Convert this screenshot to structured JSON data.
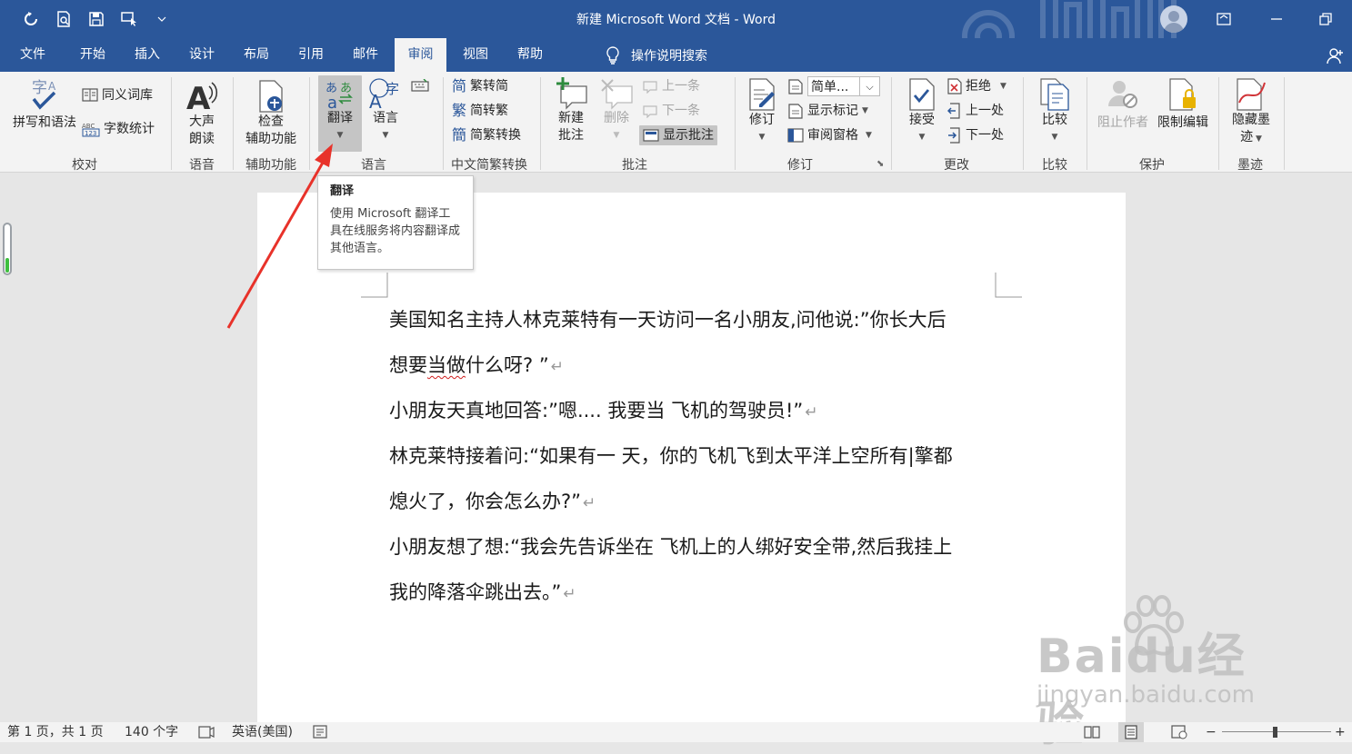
{
  "window": {
    "title": "新建 Microsoft Word 文档  -  Word"
  },
  "quick_access": [
    {
      "name": "autosave-icon"
    },
    {
      "name": "print-preview-icon"
    },
    {
      "name": "save-icon"
    },
    {
      "name": "touch-mode-icon"
    },
    {
      "name": "customize-qat-icon"
    }
  ],
  "tabs": [
    "文件",
    "开始",
    "插入",
    "设计",
    "布局",
    "引用",
    "邮件",
    "审阅",
    "视图",
    "帮助"
  ],
  "active_tab": "审阅",
  "tell_me": "操作说明搜索",
  "ribbon": {
    "proofing": {
      "label": "校对",
      "spelling": "拼写和语法",
      "thesaurus": "同义词库",
      "word_count": "字数统计"
    },
    "speech": {
      "label": "语音",
      "read_aloud_1": "大声",
      "read_aloud_2": "朗读"
    },
    "accessibility": {
      "label": "辅助功能",
      "check_1": "检查",
      "check_2": "辅助功能"
    },
    "language": {
      "label": "语言",
      "translate": "翻译",
      "language": "语言"
    },
    "chinese_conversion": {
      "label": "中文简繁转换",
      "to_simplified": "繁转简",
      "to_traditional": "简转繁",
      "convert": "简繁转换"
    },
    "comments": {
      "label": "批注",
      "new_1": "新建",
      "new_2": "批注",
      "delete": "删除",
      "previous": "上一条",
      "next": "下一条",
      "show": "显示批注"
    },
    "tracking": {
      "label": "修订",
      "track": "修订",
      "markup_select": "简单...",
      "show_markup": "显示标记",
      "reviewing_pane": "审阅窗格"
    },
    "changes": {
      "label": "更改",
      "accept": "接受",
      "reject": "拒绝",
      "previous": "上一处",
      "next": "下一处"
    },
    "compare": {
      "label": "比较",
      "compare": "比较"
    },
    "protect": {
      "label": "保护",
      "block_authors": "阻止作者",
      "restrict": "限制编辑"
    },
    "ink": {
      "label": "墨迹",
      "hide_1": "隐藏墨",
      "hide_2": "迹"
    }
  },
  "tooltip": {
    "title": "翻译",
    "body": "使用 Microsoft 翻译工具在线服务将内容翻译成其他语言。"
  },
  "document": {
    "paragraphs": [
      "美国知名主持人林克莱特有一天访问一名小朋友,问他说:”你长大后",
      "想要",
      "当做",
      "什么呀? ”",
      "小朋友天真地回答:”嗯....  我要当  飞机的驾驶员!”",
      "林克莱特接着问:“如果有一  天，你的飞机飞到太平洋上空所有|擎都",
      "熄火了，你会怎么办?”",
      "小朋友想了想:“我会先告诉坐在  飞机上的人绑好安全带,然后我挂上",
      "我的降落伞跳出去。”"
    ],
    "para_mark": "↵"
  },
  "status": {
    "page": "第 1 页，共 1 页",
    "words": "140 个字",
    "language": "英语(美国)"
  },
  "watermark": {
    "brand": "Baidu经验",
    "url": "jingyan.baidu.com"
  },
  "colors": {
    "title_bar": "#2b579a",
    "ribbon_bg": "#f3f3f3",
    "arrow": "#e8322a"
  }
}
